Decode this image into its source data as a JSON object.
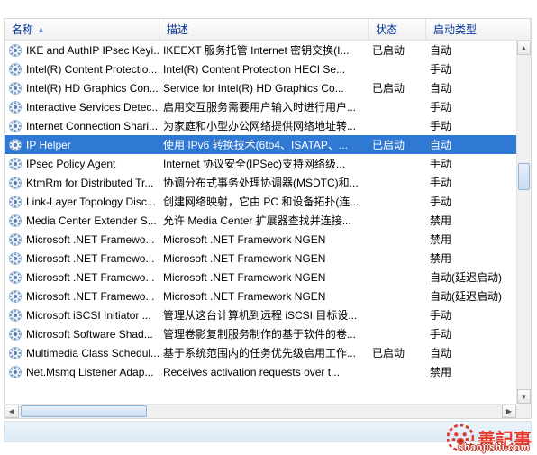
{
  "columns": {
    "name": "名称",
    "desc": "描述",
    "status": "状态",
    "type": "启动类型"
  },
  "selected_index": 5,
  "services": [
    {
      "name": "IKE and AuthIP IPsec Keyi...",
      "desc": "IKEEXT 服务托管 Internet 密钥交换(I...",
      "status": "已启动",
      "type": "自动"
    },
    {
      "name": "Intel(R) Content Protectio...",
      "desc": "Intel(R) Content Protection HECI Se...",
      "status": "",
      "type": "手动"
    },
    {
      "name": "Intel(R) HD Graphics Con...",
      "desc": "Service for Intel(R) HD Graphics Co...",
      "status": "已启动",
      "type": "自动"
    },
    {
      "name": "Interactive Services Detec...",
      "desc": "启用交互服务需要用户输入时进行用户...",
      "status": "",
      "type": "手动"
    },
    {
      "name": "Internet Connection Shari...",
      "desc": "为家庭和小型办公网络提供网络地址转...",
      "status": "",
      "type": "手动"
    },
    {
      "name": "IP Helper",
      "desc": "使用 IPv6 转换技术(6to4、ISATAP、...",
      "status": "已启动",
      "type": "自动"
    },
    {
      "name": "IPsec Policy Agent",
      "desc": "Internet 协议安全(IPSec)支持网络级...",
      "status": "",
      "type": "手动"
    },
    {
      "name": "KtmRm for Distributed Tr...",
      "desc": "协调分布式事务处理协调器(MSDTC)和...",
      "status": "",
      "type": "手动"
    },
    {
      "name": "Link-Layer Topology Disc...",
      "desc": "创建网络映射，它由 PC 和设备拓扑(连...",
      "status": "",
      "type": "手动"
    },
    {
      "name": "Media Center Extender S...",
      "desc": "允许 Media Center 扩展器查找并连接...",
      "status": "",
      "type": "禁用"
    },
    {
      "name": "Microsoft .NET Framewo...",
      "desc": "Microsoft .NET Framework NGEN",
      "status": "",
      "type": "禁用"
    },
    {
      "name": "Microsoft .NET Framewo...",
      "desc": "Microsoft .NET Framework NGEN",
      "status": "",
      "type": "禁用"
    },
    {
      "name": "Microsoft .NET Framewo...",
      "desc": "Microsoft .NET Framework NGEN",
      "status": "",
      "type": "自动(延迟启动)"
    },
    {
      "name": "Microsoft .NET Framewo...",
      "desc": "Microsoft .NET Framework NGEN",
      "status": "",
      "type": "自动(延迟启动)"
    },
    {
      "name": "Microsoft iSCSI Initiator ...",
      "desc": "管理从这台计算机到远程 iSCSI 目标设...",
      "status": "",
      "type": "手动"
    },
    {
      "name": "Microsoft Software Shad...",
      "desc": "管理卷影复制服务制作的基于软件的卷...",
      "status": "",
      "type": "手动"
    },
    {
      "name": "Multimedia Class Schedul...",
      "desc": "基于系统范围内的任务优先级启用工作...",
      "status": "已启动",
      "type": "自动"
    },
    {
      "name": "Net.Msmq Listener Adap...",
      "desc": "Receives activation requests over t...",
      "status": "",
      "type": "禁用"
    }
  ],
  "watermark": {
    "brand": "善記事",
    "url": "shanjishi.com"
  }
}
